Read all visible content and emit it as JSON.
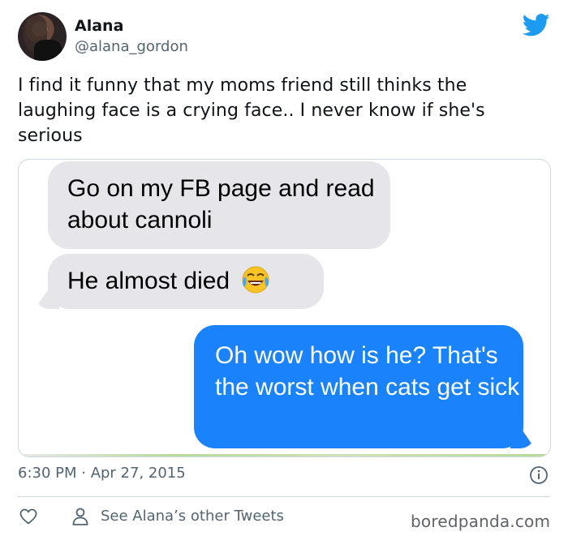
{
  "author": {
    "name": "Alana",
    "handle": "@alana_gordon"
  },
  "tweet": {
    "text": "I find it funny that my moms friend still thinks the laughing face is a crying face.. I never know if she's serious"
  },
  "messages": [
    {
      "side": "received",
      "text": "Go on my FB page and read about cannoli"
    },
    {
      "side": "received",
      "text": "He almost died",
      "emoji": "face-with-tears-of-joy"
    },
    {
      "side": "sent",
      "text": "Oh wow how is he? That's the worst when cats get sick"
    }
  ],
  "meta": {
    "timestamp": "6:30 PM · Apr 27, 2015",
    "see_other": "See Alana’s other Tweets"
  },
  "watermark": "boredpanda.com",
  "colors": {
    "twitter_blue": "#1d9bf0",
    "sent_bubble": "#1a82fb",
    "received_bubble": "#e5e5ea",
    "secondary_text": "#536471"
  }
}
